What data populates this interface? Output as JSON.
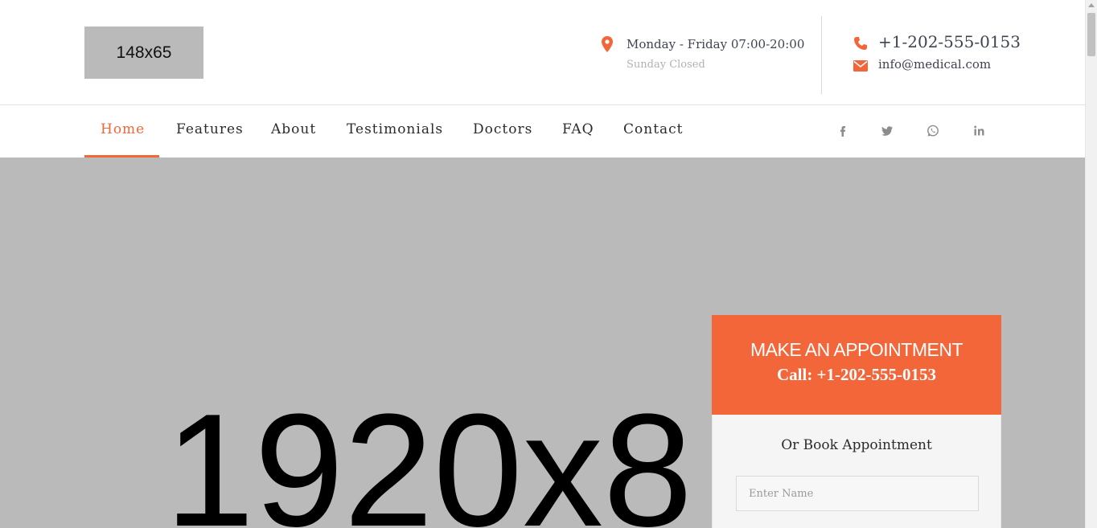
{
  "logo": {
    "text": "148x65"
  },
  "hours": {
    "main": "Monday - Friday 07:00-20:00",
    "sub": "Sunday Closed",
    "icon": "map-pin-icon"
  },
  "contact": {
    "phone": "+1-202-555-0153",
    "email": "info@medical.com",
    "phone_icon": "phone-icon",
    "email_icon": "envelope-icon"
  },
  "nav": {
    "items": [
      {
        "label": "Home",
        "active": true
      },
      {
        "label": "Features"
      },
      {
        "label": "About"
      },
      {
        "label": "Testimonials"
      },
      {
        "label": "Doctors"
      },
      {
        "label": "FAQ"
      },
      {
        "label": "Contact"
      }
    ],
    "social": [
      "facebook-icon",
      "twitter-icon",
      "whatsapp-icon",
      "linkedin-icon"
    ]
  },
  "hero": {
    "placeholder": "1920x8"
  },
  "appointment": {
    "title": "MAKE AN APPOINTMENT",
    "call": "Call: +1-202-555-0153",
    "subtitle": "Or Book Appointment",
    "name_placeholder": "Enter Name"
  },
  "colors": {
    "accent": "#f2663a",
    "hero_bg": "#bababa",
    "text": "#2b2b2b"
  }
}
